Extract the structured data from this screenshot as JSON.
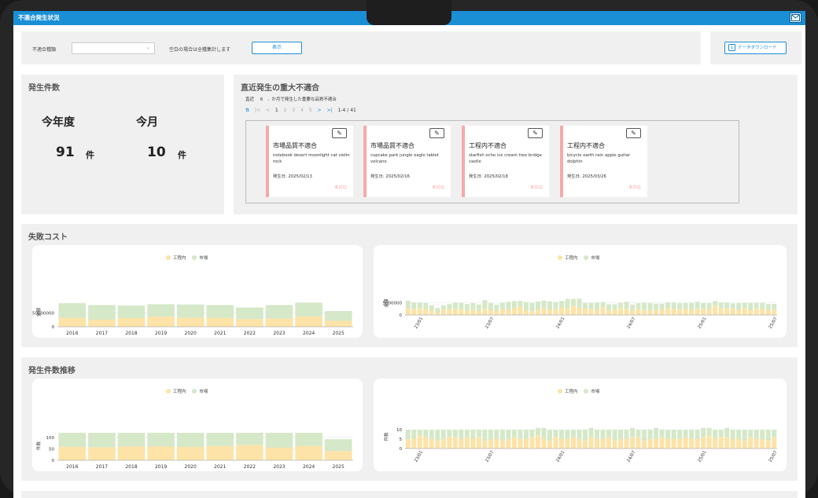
{
  "app": {
    "title": "不適合発生状況"
  },
  "filter": {
    "type_label": "不適合種類",
    "type_value": "",
    "note": "空白の場合は全種集計します",
    "show_button": "表示",
    "download_button": "データダウンロード"
  },
  "counts": {
    "title": "発生件数",
    "year_label": "今年度",
    "month_label": "今月",
    "year_value": "91",
    "month_value": "10",
    "unit": "件"
  },
  "recent": {
    "title": "直近発生の重大不適合",
    "period_prefix": "直近",
    "period_value": "6",
    "period_suffix": "か月で発生した重要な品質不適合",
    "pager": {
      "first": "|<",
      "prev": "<",
      "pages": [
        "1",
        "2",
        "3",
        "4",
        "5"
      ],
      "next": ">",
      "last": ">|",
      "range": "1-4 / 41"
    },
    "cards": [
      {
        "title": "市場品質不適合",
        "desc": "notebook desert moonlight cat violin rock",
        "date_label": "発生日:",
        "date": "2025/02/13",
        "status": "未対応"
      },
      {
        "title": "市場品質不適合",
        "desc": "cupcake park jungle eagle tablet volcano",
        "date_label": "発生日:",
        "date": "2025/02/16",
        "status": "未対応"
      },
      {
        "title": "工程内不適合",
        "desc": "starfish echo ice cream tree bridge castle",
        "date_label": "発生日:",
        "date": "2025/02/18",
        "status": "未対応"
      },
      {
        "title": "工程内不適合",
        "desc": "bicycle earth rain apple guitar dolphin",
        "date_label": "発生日:",
        "date": "2025/03/26",
        "status": "未対応"
      }
    ]
  },
  "colors": {
    "accent": "#1a8fd6",
    "in_process": "#fde3a7",
    "market": "#d5e8c8",
    "status": "#f7a9a9"
  },
  "cost_section": {
    "title": "失敗コスト",
    "legend": [
      "工程内",
      "市場"
    ]
  },
  "count_section": {
    "title": "発生件数推移",
    "legend": [
      "工程内",
      "市場"
    ]
  },
  "chart_data": [
    {
      "type": "bar",
      "stacked": true,
      "ylabel": "金額",
      "ylim": [
        0,
        110000000
      ],
      "yticks": [
        "0",
        "50000000"
      ],
      "ytick_values": [
        0,
        50000000
      ],
      "categories": [
        "2016",
        "2017",
        "2018",
        "2019",
        "2020",
        "2021",
        "2022",
        "2023",
        "2024",
        "2025"
      ],
      "series": [
        {
          "name": "工程内",
          "values": [
            33000000,
            26000000,
            32000000,
            37000000,
            33000000,
            33000000,
            28000000,
            30000000,
            38000000,
            22000000
          ]
        },
        {
          "name": "市場",
          "values": [
            54000000,
            54000000,
            46000000,
            46000000,
            49000000,
            47000000,
            43000000,
            50000000,
            51000000,
            36000000
          ]
        }
      ]
    },
    {
      "type": "bar",
      "stacked": true,
      "ylabel": "金額",
      "ylim": [
        0,
        10000000
      ],
      "yticks": [
        "0",
        "5000000"
      ],
      "ytick_values": [
        0,
        5000000
      ],
      "categories": [
        "23/01",
        "23/07",
        "24/01",
        "24/07",
        "25/01",
        "25/07"
      ],
      "series": [
        {
          "name": "工程内",
          "values": [
            2600000,
            2400000,
            2700000,
            2400000,
            1900000,
            800000,
            2300000,
            2200000,
            2500000,
            2400000,
            1700000,
            2300000,
            1500000,
            2600000,
            2100000,
            1600000,
            2400000,
            2200000,
            2900000,
            3400000,
            1900000,
            1400000,
            2200000,
            2900000,
            2100000,
            2300000,
            3100000,
            2700000,
            3900000,
            3100000,
            2600000,
            2400000,
            2100000,
            3200000,
            1700000,
            2300000,
            2800000,
            2500000,
            1700000,
            2400000,
            2000000,
            1900000,
            2200000,
            2000000,
            2900000,
            2500000,
            2200000,
            2600000,
            2100000,
            2500000,
            2600000,
            2300000,
            3800000,
            2700000,
            2600000,
            2500000,
            2000000,
            2900000,
            2000000,
            2700000,
            2600000,
            1900000,
            2200000
          ]
        },
        {
          "name": "市場",
          "values": [
            3300000,
            2800000,
            2400000,
            2500000,
            2100000,
            2100000,
            1700000,
            2300000,
            2600000,
            2500000,
            2800000,
            2600000,
            2800000,
            3500000,
            2800000,
            2600000,
            2600000,
            3200000,
            2800000,
            2400000,
            3400000,
            3600000,
            3300000,
            3000000,
            3500000,
            3000000,
            2700000,
            3900000,
            2700000,
            3600000,
            2300000,
            2600000,
            3100000,
            2100000,
            2700000,
            2100000,
            2200000,
            2900000,
            2600000,
            2400000,
            3000000,
            2900000,
            2400000,
            2600000,
            2300000,
            2700000,
            2600000,
            2300000,
            2800000,
            2900000,
            2300000,
            2500000,
            1900000,
            2400000,
            2500000,
            2200000,
            2800000,
            2100000,
            2900000,
            2300000,
            2300000,
            2600000,
            2300000
          ]
        }
      ]
    },
    {
      "type": "bar",
      "stacked": true,
      "ylabel": "件数",
      "ylim": [
        0,
        130
      ],
      "yticks": [
        "0",
        "50",
        "100"
      ],
      "ytick_values": [
        0,
        50,
        100
      ],
      "categories": [
        "2016",
        "2017",
        "2018",
        "2019",
        "2020",
        "2021",
        "2022",
        "2023",
        "2024",
        "2025"
      ],
      "series": [
        {
          "name": "工程内",
          "values": [
            58,
            56,
            60,
            60,
            58,
            62,
            66,
            55,
            62,
            40
          ]
        },
        {
          "name": "市場",
          "values": [
            62,
            64,
            60,
            60,
            62,
            58,
            54,
            65,
            58,
            52
          ]
        }
      ]
    },
    {
      "type": "bar",
      "stacked": true,
      "ylabel": "件数",
      "ylim": [
        0,
        13
      ],
      "yticks": [
        "0",
        "5",
        "10"
      ],
      "ytick_values": [
        0,
        5,
        10
      ],
      "categories": [
        "23/01",
        "23/07",
        "24/01",
        "24/07",
        "25/01",
        "25/07"
      ],
      "series": [
        {
          "name": "工程内",
          "values": [
            5,
            5,
            7,
            6,
            5,
            4,
            5,
            6,
            6,
            5,
            6,
            5,
            6,
            4,
            5,
            5,
            4,
            5,
            6,
            5,
            5,
            6,
            7,
            5,
            4,
            6,
            5,
            5,
            6,
            5,
            4,
            6,
            5,
            5,
            6,
            4,
            5,
            5,
            6,
            6,
            4,
            5,
            5,
            6,
            5,
            5,
            5,
            6,
            5,
            5,
            6,
            7,
            5,
            6,
            6,
            5,
            5,
            4,
            6,
            5,
            5,
            4,
            6
          ]
        },
        {
          "name": "市場",
          "values": [
            5,
            5,
            3,
            4,
            5,
            6,
            5,
            4,
            4,
            5,
            4,
            5,
            4,
            6,
            5,
            5,
            6,
            5,
            4,
            5,
            5,
            4,
            4,
            6,
            6,
            4,
            5,
            5,
            4,
            5,
            6,
            5,
            5,
            5,
            4,
            6,
            5,
            5,
            5,
            4,
            6,
            5,
            6,
            4,
            5,
            5,
            5,
            4,
            5,
            5,
            5,
            4,
            5,
            4,
            5,
            5,
            5,
            6,
            4,
            5,
            5,
            6,
            4
          ]
        }
      ]
    }
  ]
}
